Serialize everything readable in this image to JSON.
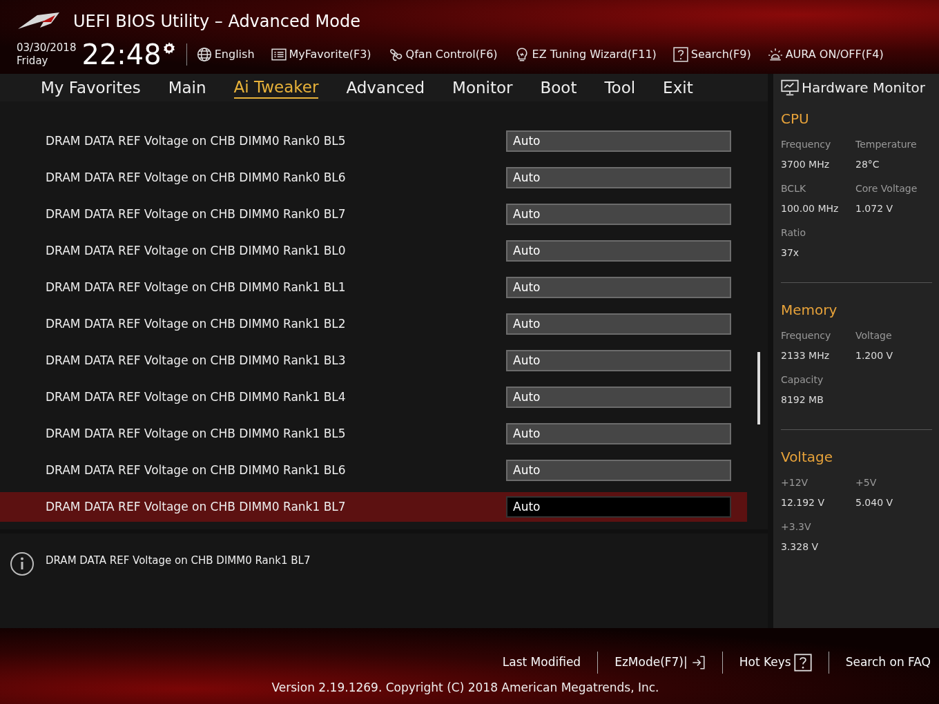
{
  "header": {
    "title": "UEFI BIOS Utility – Advanced Mode",
    "date": "03/30/2018",
    "day": "Friday",
    "time": "22:48",
    "tools": [
      {
        "label": "English"
      },
      {
        "label": "MyFavorite(F3)"
      },
      {
        "label": "Qfan Control(F6)"
      },
      {
        "label": "EZ Tuning Wizard(F11)"
      },
      {
        "label": "Search(F9)"
      },
      {
        "label": "AURA ON/OFF(F4)"
      }
    ]
  },
  "tabs": [
    {
      "label": "My Favorites",
      "selected": false
    },
    {
      "label": "Main",
      "selected": false
    },
    {
      "label": "Ai Tweaker",
      "selected": true
    },
    {
      "label": "Advanced",
      "selected": false
    },
    {
      "label": "Monitor",
      "selected": false
    },
    {
      "label": "Boot",
      "selected": false
    },
    {
      "label": "Tool",
      "selected": false
    },
    {
      "label": "Exit",
      "selected": false
    }
  ],
  "settings": [
    {
      "label": "DRAM DATA REF Voltage on CHB DIMM0 Rank0 BL5",
      "value": "Auto",
      "selected": false
    },
    {
      "label": "DRAM DATA REF Voltage on CHB DIMM0 Rank0 BL6",
      "value": "Auto",
      "selected": false
    },
    {
      "label": "DRAM DATA REF Voltage on CHB DIMM0 Rank0 BL7",
      "value": "Auto",
      "selected": false
    },
    {
      "label": "DRAM DATA REF Voltage on CHB DIMM0 Rank1 BL0",
      "value": "Auto",
      "selected": false
    },
    {
      "label": "DRAM DATA REF Voltage on CHB DIMM0 Rank1 BL1",
      "value": "Auto",
      "selected": false
    },
    {
      "label": "DRAM DATA REF Voltage on CHB DIMM0 Rank1 BL2",
      "value": "Auto",
      "selected": false
    },
    {
      "label": "DRAM DATA REF Voltage on CHB DIMM0 Rank1 BL3",
      "value": "Auto",
      "selected": false
    },
    {
      "label": "DRAM DATA REF Voltage on CHB DIMM0 Rank1 BL4",
      "value": "Auto",
      "selected": false
    },
    {
      "label": "DRAM DATA REF Voltage on CHB DIMM0 Rank1 BL5",
      "value": "Auto",
      "selected": false
    },
    {
      "label": "DRAM DATA REF Voltage on CHB DIMM0 Rank1 BL6",
      "value": "Auto",
      "selected": false
    },
    {
      "label": "DRAM DATA REF Voltage on CHB DIMM0 Rank1 BL7",
      "value": "Auto",
      "selected": true
    }
  ],
  "help": {
    "text": "DRAM DATA REF Voltage on CHB DIMM0 Rank1 BL7"
  },
  "hardware_monitor": {
    "title": "Hardware Monitor",
    "sections": [
      {
        "title": "CPU",
        "items": [
          {
            "label": "Frequency",
            "value": "3700 MHz"
          },
          {
            "label": "Temperature",
            "value": "28°C"
          },
          {
            "label": "BCLK",
            "value": "100.00 MHz"
          },
          {
            "label": "Core Voltage",
            "value": "1.072 V"
          },
          {
            "label": "Ratio",
            "value": "37x"
          }
        ]
      },
      {
        "title": "Memory",
        "items": [
          {
            "label": "Frequency",
            "value": "2133 MHz"
          },
          {
            "label": "Voltage",
            "value": "1.200 V"
          },
          {
            "label": "Capacity",
            "value": "8192 MB"
          }
        ]
      },
      {
        "title": "Voltage",
        "items": [
          {
            "label": "+12V",
            "value": "12.192 V"
          },
          {
            "label": "+5V",
            "value": "5.040 V"
          },
          {
            "label": "+3.3V",
            "value": "3.328 V"
          }
        ]
      }
    ]
  },
  "footer": {
    "links": [
      "Last Modified",
      "EzMode(F7)|",
      "Hot Keys"
    ],
    "faq": "Search on FAQ",
    "version": "Version 2.19.1269. Copyright (C) 2018 American Megatrends, Inc."
  }
}
